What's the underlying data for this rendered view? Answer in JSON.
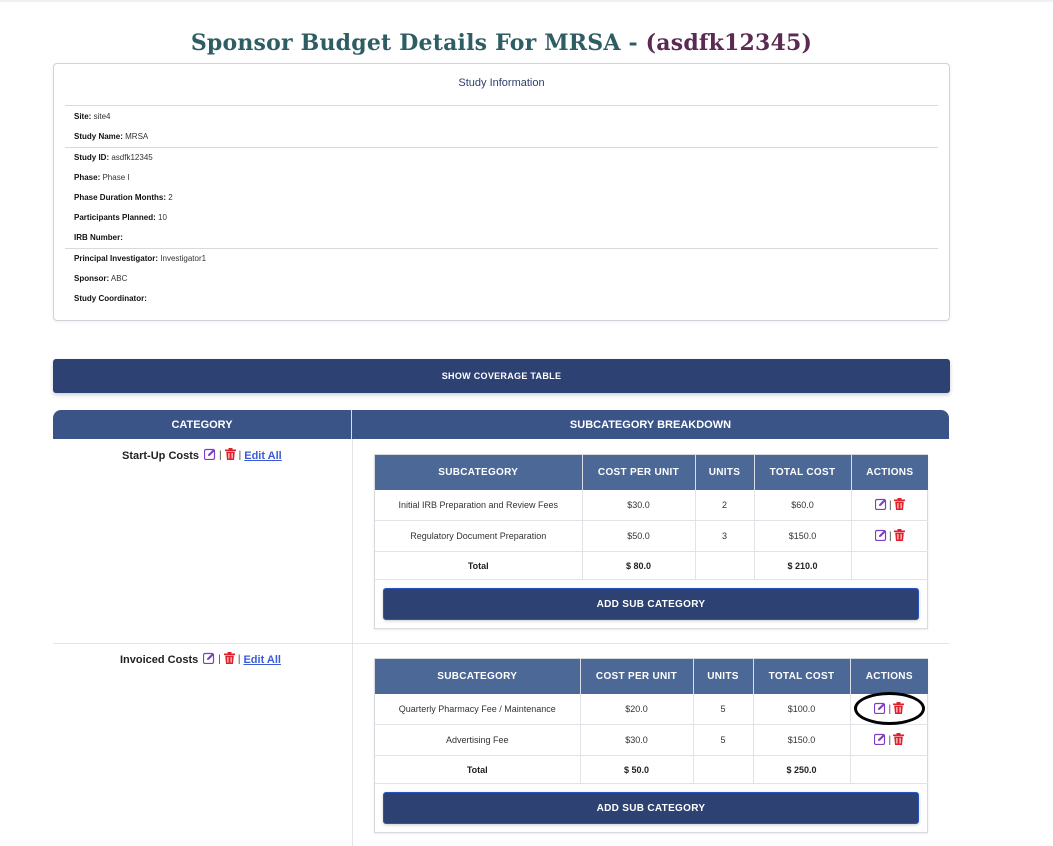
{
  "page": {
    "title_part1": "Sponsor Budget Details For MRSA - ",
    "title_part2": "(asdfk12345)"
  },
  "study_info": {
    "title": "Study Information",
    "fields": {
      "site": {
        "label": "Site:",
        "value": "site4"
      },
      "study_name": {
        "label": "Study Name:",
        "value": "MRSA"
      },
      "study_id": {
        "label": "Study ID:",
        "value": "asdfk12345"
      },
      "phase": {
        "label": "Phase:",
        "value": "Phase I"
      },
      "phase_duration": {
        "label": "Phase Duration Months:",
        "value": "2"
      },
      "participants": {
        "label": "Participants Planned:",
        "value": "10"
      },
      "irb": {
        "label": "IRB Number:",
        "value": ""
      },
      "pi": {
        "label": "Principal Investigator:",
        "value": "Investigator1"
      },
      "sponsor": {
        "label": "Sponsor:",
        "value": "ABC"
      },
      "coordinator": {
        "label": "Study Coordinator:",
        "value": ""
      }
    }
  },
  "coverage_button": "SHOW COVERAGE TABLE",
  "main_table": {
    "category_header": "CATEGORY",
    "breakdown_header": "SUBCATEGORY BREAKDOWN"
  },
  "sub_headers": {
    "subcategory": "SUBCATEGORY",
    "cost_per_unit": "COST PER UNIT",
    "units": "UNITS",
    "total_cost": "TOTAL COST",
    "actions": "ACTIONS"
  },
  "edit_all_label": "Edit All",
  "pipe": "|",
  "add_sub_category": "ADD SUB CATEGORY",
  "categories": [
    {
      "name": "Start-Up Costs",
      "rows": [
        {
          "subcategory": "Initial IRB Preparation and Review Fees",
          "cost_per_unit": "$30.0",
          "units": "2",
          "total_cost": "$60.0"
        },
        {
          "subcategory": "Regulatory Document Preparation",
          "cost_per_unit": "$50.0",
          "units": "3",
          "total_cost": "$150.0"
        }
      ],
      "total": {
        "label": "Total",
        "cost_per_unit": "$ 80.0",
        "units": "",
        "total_cost": "$ 210.0"
      }
    },
    {
      "name": "Invoiced Costs",
      "rows": [
        {
          "subcategory": "Quarterly Pharmacy Fee / Maintenance",
          "cost_per_unit": "$20.0",
          "units": "5",
          "total_cost": "$100.0"
        },
        {
          "subcategory": "Advertising Fee",
          "cost_per_unit": "$30.0",
          "units": "5",
          "total_cost": "$150.0"
        }
      ],
      "total": {
        "label": "Total",
        "cost_per_unit": "$ 50.0",
        "units": "",
        "total_cost": "$ 250.0"
      }
    }
  ],
  "colors": {
    "primary": "#2e4173",
    "header": "#3b5488",
    "sub_header": "#4c6897",
    "edit_icon": "#7b3fc4",
    "delete_icon": "#e0202a",
    "link": "#3b5bd6"
  },
  "icons": {
    "edit": "edit-icon",
    "delete": "trash-icon"
  }
}
